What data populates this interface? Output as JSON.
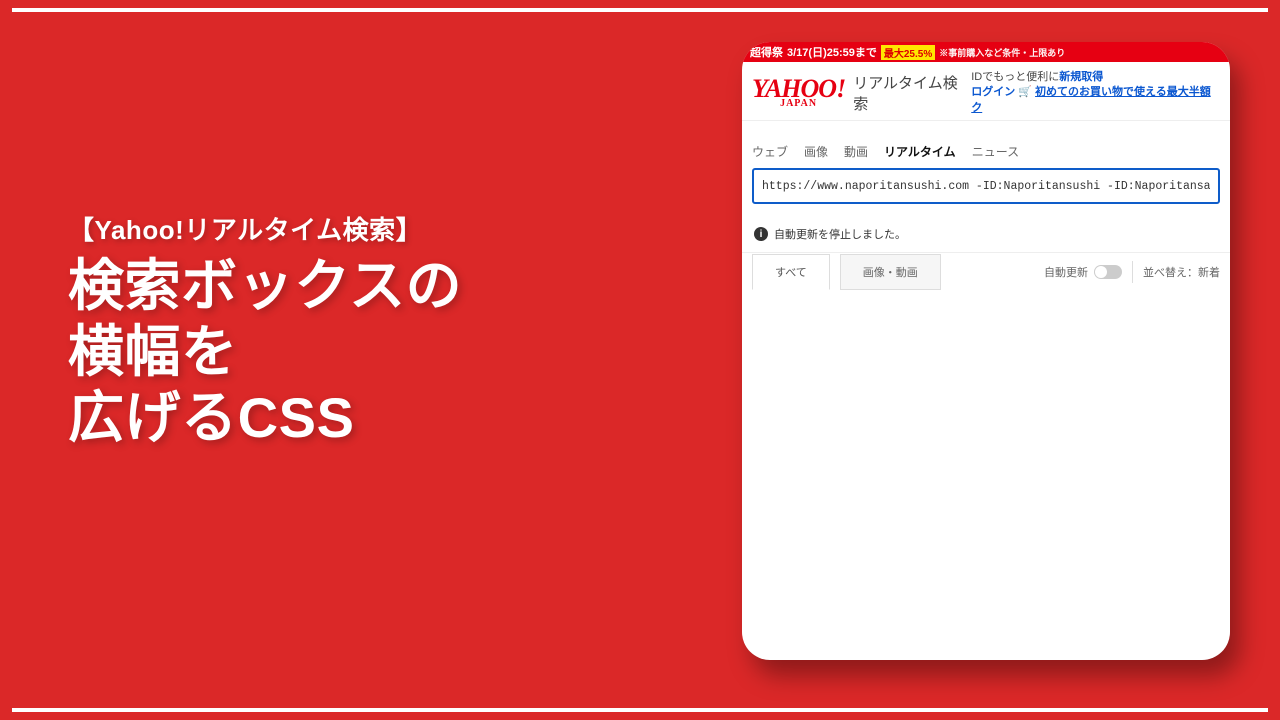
{
  "left": {
    "subtitle": "【Yahoo!リアルタイム検索】",
    "title_l1": "検索ボックスの",
    "title_l2": "横幅を",
    "title_l3": "広げるCSS"
  },
  "promo": {
    "prefix": "超得祭",
    "date_text": "3/17(日)25:59まで",
    "badge_prefix": "最大",
    "badge_value": "25.5%",
    "note": "※事前購入など条件・上限あり"
  },
  "header": {
    "logo_main": "YAHOO!",
    "logo_sub": "JAPAN",
    "realtime": "リアルタイム検索",
    "right_line1_prefix": "IDでもっと便利に",
    "right_line1_link": "新規取得",
    "login": "ログイン",
    "cart": "🛒",
    "promo_text": "初めてのお買い物で使える最大半額ク"
  },
  "tabs": [
    {
      "label": "ウェブ",
      "active": false
    },
    {
      "label": "画像",
      "active": false
    },
    {
      "label": "動画",
      "active": false
    },
    {
      "label": "リアルタイム",
      "active": true
    },
    {
      "label": "ニュース",
      "active": false
    }
  ],
  "search": {
    "value": "https://www.naporitansushi.com -ID:Naporitansushi -ID:Naporitansabu"
  },
  "status": {
    "text": "自動更新を停止しました。"
  },
  "filters": {
    "tab_all": "すべて",
    "tab_media": "画像・動画",
    "auto_update": "自動更新",
    "sort": "並べ替え：新着"
  }
}
